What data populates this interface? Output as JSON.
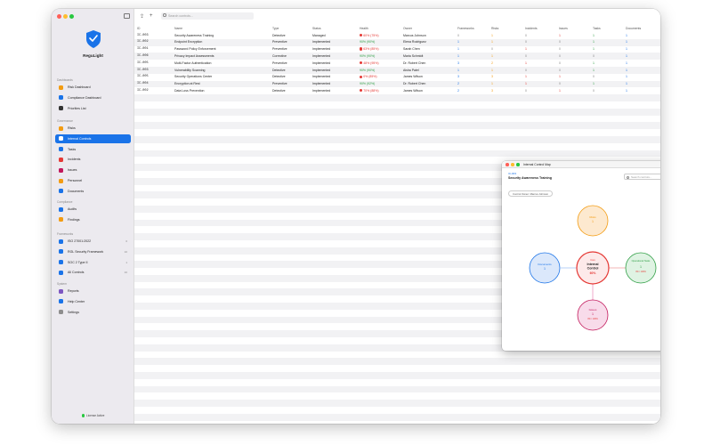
{
  "app": {
    "name": "ReguLight",
    "license": "License Active"
  },
  "toolbar": {
    "search_placeholder": "Search controls..."
  },
  "sidebar": {
    "sections": [
      {
        "title": "Dashboards",
        "items": [
          {
            "label": "Risk Dashboard",
            "icon": "gauge-icon",
            "color": "#f39c12"
          },
          {
            "label": "Compliance Dashboard",
            "icon": "chart-icon",
            "color": "#1a73e8"
          },
          {
            "label": "Priorities List",
            "icon": "target-icon",
            "color": "#333333"
          }
        ]
      },
      {
        "title": "Governance",
        "items": [
          {
            "label": "Risks",
            "icon": "warning-icon",
            "color": "#f39c12"
          },
          {
            "label": "Internal Controls",
            "icon": "shield-icon",
            "color": "#1a73e8",
            "active": true
          },
          {
            "label": "Tasks",
            "icon": "checklist-icon",
            "color": "#1a73e8"
          },
          {
            "label": "Incidents",
            "icon": "bell-icon",
            "color": "#e53935"
          },
          {
            "label": "Issues",
            "icon": "flag-icon",
            "color": "#c2185b"
          },
          {
            "label": "Personnel",
            "icon": "people-icon",
            "color": "#f39c12"
          },
          {
            "label": "Documents",
            "icon": "document-icon",
            "color": "#1a73e8"
          }
        ]
      },
      {
        "title": "Compliance",
        "items": [
          {
            "label": "Audits",
            "icon": "magnifier-icon",
            "color": "#1a73e8"
          },
          {
            "label": "Findings",
            "icon": "finding-icon",
            "color": "#f39c12"
          }
        ]
      },
      {
        "title": "Frameworks",
        "items": [
          {
            "label": "ISO 27001:2022",
            "icon": "framework-icon",
            "color": "#1a73e8",
            "count": "0"
          },
          {
            "label": "RGL Security Framework",
            "icon": "framework-icon",
            "color": "#1a73e8",
            "count": "10"
          },
          {
            "label": "SOC 2 Type II",
            "icon": "framework-icon",
            "color": "#1a73e8",
            "count": "1"
          },
          {
            "label": "All Controls",
            "icon": "framework-icon",
            "color": "#1a73e8",
            "count": "10"
          }
        ]
      },
      {
        "title": "System",
        "items": [
          {
            "label": "Reports",
            "icon": "report-icon",
            "color": "#7e57c2"
          },
          {
            "label": "Help Center",
            "icon": "help-icon",
            "color": "#1a73e8"
          },
          {
            "label": "Settings",
            "icon": "gear-icon",
            "color": "#8e8e8e"
          }
        ]
      }
    ]
  },
  "table": {
    "headers": [
      "ID",
      "Name",
      "Type",
      "Status",
      "Health",
      "Owner",
      "Frameworks",
      "Risks",
      "Incidents",
      "Issues",
      "Tasks",
      "Documents"
    ],
    "rows": [
      {
        "id": "IC-003",
        "name": "Security Awareness Training",
        "type": "Detective",
        "status": "Managed",
        "health": "60% (75%)",
        "health_level": "red",
        "health_warn": true,
        "owner": "Marcus Johnson",
        "frameworks": "0",
        "risks": "1",
        "incidents": "0",
        "issues": "1",
        "tasks": "1",
        "documents": "1"
      },
      {
        "id": "IC-002",
        "name": "Endpoint Encryption",
        "type": "Preventive",
        "status": "Implemented",
        "health": "90% (90%)",
        "health_level": "green",
        "health_warn": false,
        "owner": "Elena Rodriguez",
        "frameworks": "1",
        "risks": "1",
        "incidents": "0",
        "issues": "0",
        "tasks": "1",
        "documents": "1"
      },
      {
        "id": "IC-001",
        "name": "Password Policy Enforcement",
        "type": "Preventive",
        "status": "Implemented",
        "health": "63% (85%)",
        "health_level": "red",
        "health_warn": true,
        "owner": "Sarah Chen",
        "frameworks": "1",
        "risks": "0",
        "incidents": "1",
        "issues": "0",
        "tasks": "1",
        "documents": "1"
      },
      {
        "id": "IC-006",
        "name": "Privacy Impact Assessments",
        "type": "Corrective",
        "status": "Implemented",
        "health": "90% (90%)",
        "health_level": "green",
        "health_warn": false,
        "owner": "Maria Schmidt",
        "frameworks": "1",
        "risks": "1",
        "incidents": "0",
        "issues": "0",
        "tasks": "0",
        "documents": "1"
      },
      {
        "id": "IC-005",
        "name": "Multi-Factor Authentication",
        "type": "Preventive",
        "status": "Implemented",
        "health": "48% (95%)",
        "health_level": "red",
        "health_warn": true,
        "owner": "Dr. Robert Chen",
        "frameworks": "3",
        "risks": "2",
        "incidents": "1",
        "issues": "0",
        "tasks": "1",
        "documents": "1"
      },
      {
        "id": "IC-003",
        "name": "Vulnerability Scanning",
        "type": "Detective",
        "status": "Implemented",
        "health": "90% (90%)",
        "health_level": "green",
        "health_warn": false,
        "owner": "Aisha Patel",
        "frameworks": "1",
        "risks": "1",
        "incidents": "0",
        "issues": "0",
        "tasks": "1",
        "documents": "1"
      },
      {
        "id": "IC-005",
        "name": "Security Operations Center",
        "type": "Detective",
        "status": "Implemented",
        "health": "0% (85%)",
        "health_level": "red",
        "health_warn": true,
        "owner": "James Wilson",
        "frameworks": "3",
        "risks": "3",
        "incidents": "1",
        "issues": "1",
        "tasks": "0",
        "documents": "1"
      },
      {
        "id": "IC-004",
        "name": "Encryption at Rest",
        "type": "Preventive",
        "status": "Implemented",
        "health": "90% (92%)",
        "health_level": "green",
        "health_warn": false,
        "owner": "Dr. Robert Chen",
        "frameworks": "2",
        "risks": "1",
        "incidents": "1",
        "issues": "0",
        "tasks": "1",
        "documents": "1"
      },
      {
        "id": "IC-002",
        "name": "Data Loss Prevention",
        "type": "Detective",
        "status": "Implemented",
        "health": "70% (88%)",
        "health_level": "red",
        "health_warn": true,
        "owner": "James Wilson",
        "frameworks": "2",
        "risks": "3",
        "incidents": "0",
        "issues": "1",
        "tasks": "0",
        "documents": "1"
      }
    ]
  },
  "popup": {
    "title": "Internal Control Map",
    "control_id": "IC-003",
    "control_name": "Security Awareness Training",
    "search_placeholder": "Search controls...",
    "owner_chip": "Control Owner: Marcus Johnson",
    "center": {
      "tag": "Core",
      "label1": "Internal",
      "label2": "Control",
      "value": "60%"
    },
    "nodes": [
      {
        "key": "risks",
        "label": "Risks",
        "value": "1",
        "sub": "",
        "color": "#f39c12",
        "fill": "#fde9cf"
      },
      {
        "key": "documents",
        "label": "Documents",
        "value": "1",
        "sub": "",
        "color": "#1a73e8",
        "fill": "#dbe8fb"
      },
      {
        "key": "operational_tasks",
        "label": "Operational Tasks",
        "value": "1",
        "sub": "0% / 100%",
        "color": "#2e9e44",
        "fill": "#dff3e3"
      },
      {
        "key": "issues",
        "label": "Issues",
        "value": "1",
        "sub": "0% / 100%",
        "color": "#c2185b",
        "fill": "#f8dbea"
      }
    ]
  }
}
